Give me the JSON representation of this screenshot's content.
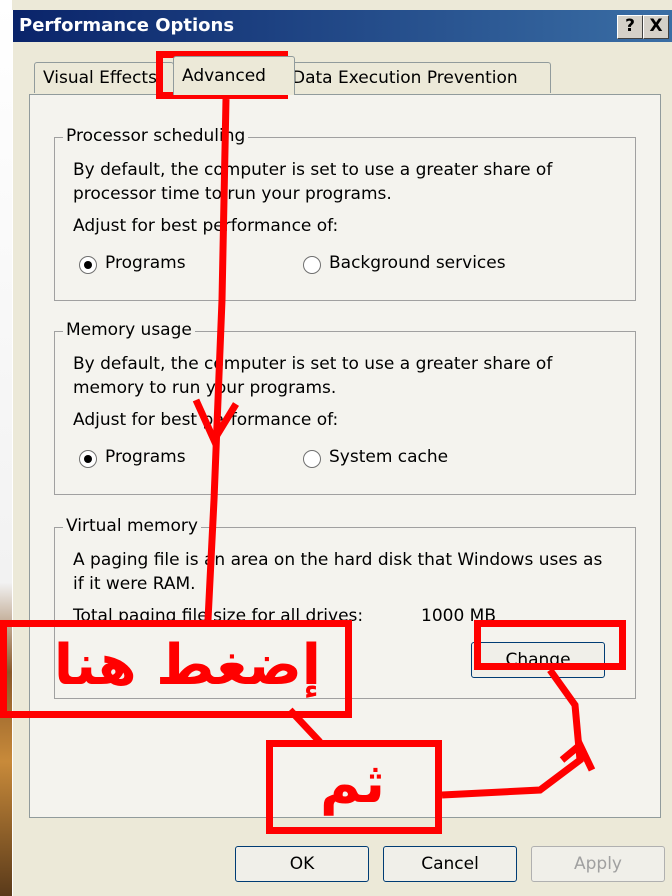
{
  "window": {
    "title": "Performance Options",
    "help_label": "?",
    "close_label": "X"
  },
  "tabs": [
    {
      "label": "Visual Effects",
      "selected": false
    },
    {
      "label": "Advanced",
      "selected": true
    },
    {
      "label": "Data Execution Prevention",
      "selected": false
    }
  ],
  "processor": {
    "legend": "Processor scheduling",
    "desc_line1": "By default, the computer is set to use a greater share of",
    "desc_line2": "processor time to run your programs.",
    "adjust": "Adjust for best performance of:",
    "options": [
      {
        "label": "Programs",
        "selected": true
      },
      {
        "label": "Background services",
        "selected": false
      }
    ]
  },
  "memory": {
    "legend": "Memory usage",
    "desc_line1": "By default, the computer is set to use a greater share of",
    "desc_line2": "memory to run your programs.",
    "adjust": "Adjust for best performance of:",
    "options": [
      {
        "label": "Programs",
        "selected": true
      },
      {
        "label": "System cache",
        "selected": false
      }
    ]
  },
  "virtual": {
    "legend": "Virtual memory",
    "desc_line1": "A paging file is an area on the hard disk that Windows uses as",
    "desc_line2": "if it were RAM.",
    "total_label": "Total paging file size for all drives:",
    "total_value": "1000 MB",
    "change_label": "Change"
  },
  "buttons": {
    "ok": "OK",
    "cancel": "Cancel",
    "apply": "Apply"
  },
  "annotations": {
    "click_here": "إضغط هنا",
    "then": "ثم",
    "color": "#ff0000"
  }
}
